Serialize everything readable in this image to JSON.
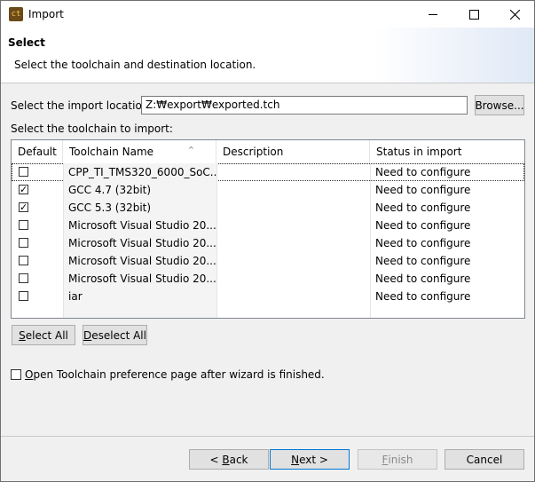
{
  "window": {
    "title": "Import",
    "icon_text": "ct"
  },
  "banner": {
    "title": "Select",
    "description": "Select the toolchain and destination location."
  },
  "location": {
    "label": "Select the import location:",
    "value": "Z:₩export₩exported.tch",
    "browse_label": "Browse..."
  },
  "toolchain_label": "Select the toolchain to import:",
  "table": {
    "columns": [
      "Default",
      "Toolchain Name",
      "Description",
      "Status in import"
    ],
    "rows": [
      {
        "checked": false,
        "name": "CPP_TI_TMS320_6000_SoC...",
        "description": "",
        "status": "Need to configure"
      },
      {
        "checked": true,
        "name": "GCC 4.7 (32bit)",
        "description": "",
        "status": "Need to configure"
      },
      {
        "checked": true,
        "name": "GCC 5.3 (32bit)",
        "description": "",
        "status": "Need to configure"
      },
      {
        "checked": false,
        "name": "Microsoft Visual Studio 20...",
        "description": "",
        "status": "Need to configure"
      },
      {
        "checked": false,
        "name": "Microsoft Visual Studio 20...",
        "description": "",
        "status": "Need to configure"
      },
      {
        "checked": false,
        "name": "Microsoft Visual Studio 20...",
        "description": "",
        "status": "Need to configure"
      },
      {
        "checked": false,
        "name": "Microsoft Visual Studio 20...",
        "description": "",
        "status": "Need to configure"
      },
      {
        "checked": false,
        "name": "iar",
        "description": "",
        "status": "Need to configure"
      }
    ]
  },
  "buttons": {
    "select_all": {
      "mnemonic": "S",
      "rest": "elect All"
    },
    "deselect_all": {
      "mnemonic": "D",
      "rest": "eselect All"
    },
    "back": {
      "pre": "< ",
      "mnemonic": "B",
      "rest": "ack"
    },
    "next": {
      "mnemonic": "N",
      "rest": "ext >"
    },
    "finish": {
      "mnemonic": "F",
      "rest": "inish"
    },
    "cancel": {
      "label": "Cancel"
    }
  },
  "option": {
    "checked": false,
    "mnemonic": "O",
    "rest": "pen Toolchain preference page after wizard is finished."
  },
  "colors": {
    "default_button_border": "#0078d7",
    "banner_gradient": "#dce6f5"
  }
}
